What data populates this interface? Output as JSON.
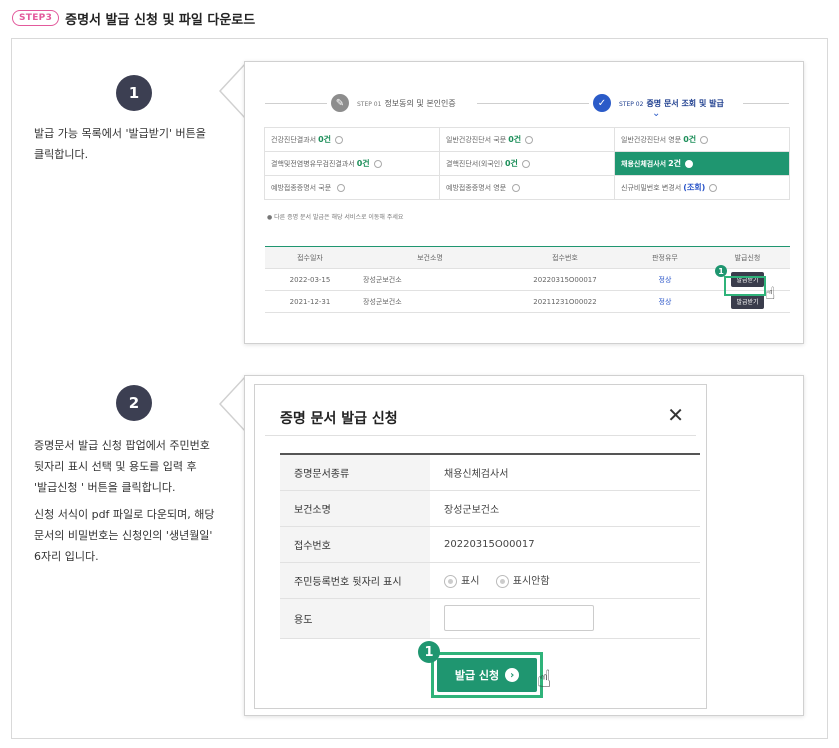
{
  "header": {
    "step_badge": "STEP3",
    "title": "증명서 발급 신청 및 파일 다운로드"
  },
  "section1": {
    "number": "1",
    "description_lines": [
      "발급 가능 목록에서 '발급받기' 버튼을",
      "클릭합니다."
    ],
    "steps": [
      {
        "tag": "STEP 01",
        "label": "정보동의 및 본인인증",
        "active": false
      },
      {
        "tag": "STEP 02",
        "label": "증명 문서 조회 및 발급",
        "active": true
      }
    ],
    "certificates": [
      {
        "name": "건강진단결과서",
        "count": "0건"
      },
      {
        "name": "일반건강진단서 국문",
        "count": "0건"
      },
      {
        "name": "일반건강진단서 영문",
        "count": "0건"
      },
      {
        "name": "결핵및전염병유무검진결과서",
        "count": "0건"
      },
      {
        "name": "결핵진단서(외국인)",
        "count": "0건"
      },
      {
        "name": "채용신체검사서",
        "count": "2건",
        "active": true
      },
      {
        "name": "예방접종증명서 국문",
        "count": ""
      },
      {
        "name": "예방접종증명서 영문",
        "count": ""
      },
      {
        "name": "신규비밀번호 변경서",
        "count": "(조회)"
      }
    ],
    "note": "● 다른 증명 문서 발급은 해당 서비스로 이동해 주세요",
    "table_headers": [
      "접수일자",
      "보건소명",
      "접수번호",
      "판정유무",
      "발급신청"
    ],
    "table_rows": [
      {
        "date": "2022-03-15",
        "center": "장성군보건소",
        "receipt": "20220315O00017",
        "status": "정상",
        "button": "발급받기"
      },
      {
        "date": "2021-12-31",
        "center": "장성군보건소",
        "receipt": "20211231O00022",
        "status": "정상",
        "button": "발급받기"
      }
    ],
    "badge": "1"
  },
  "section2": {
    "number": "2",
    "description_lines": [
      "증명문서 발급 신청 팝업에서 주민번호",
      "뒷자리 표시 선택 및 용도를 입력 후",
      "'발급신청 ' 버튼을 클릭합니다."
    ],
    "description2_lines": [
      "신청 서식이 pdf 파일로 다운되며, 해당",
      "문서의 비밀번호는 신청인의 '생년월일'",
      "6자리 입니다."
    ],
    "modal": {
      "title": "증명 문서 발급 신청",
      "close_icon": "close-icon",
      "fields": [
        {
          "label": "증명문서종류",
          "value": "채용신체검사서"
        },
        {
          "label": "보건소명",
          "value": "장성군보건소"
        },
        {
          "label": "접수번호",
          "value": "20220315O00017"
        }
      ],
      "rrn_label": "주민등록번호 뒷자리 표시",
      "radio_show": "표시",
      "radio_hide": "표시안함",
      "purpose_label": "용도",
      "purpose_value": "",
      "apply_button": "발급 신청",
      "badge": "1"
    }
  },
  "colors": {
    "accent_green": "#1f9670",
    "highlight_green": "#2fb37a",
    "badge_pink": "#e35a9c",
    "dark_navy": "#3c3f52",
    "link_blue": "#2a55c9"
  }
}
